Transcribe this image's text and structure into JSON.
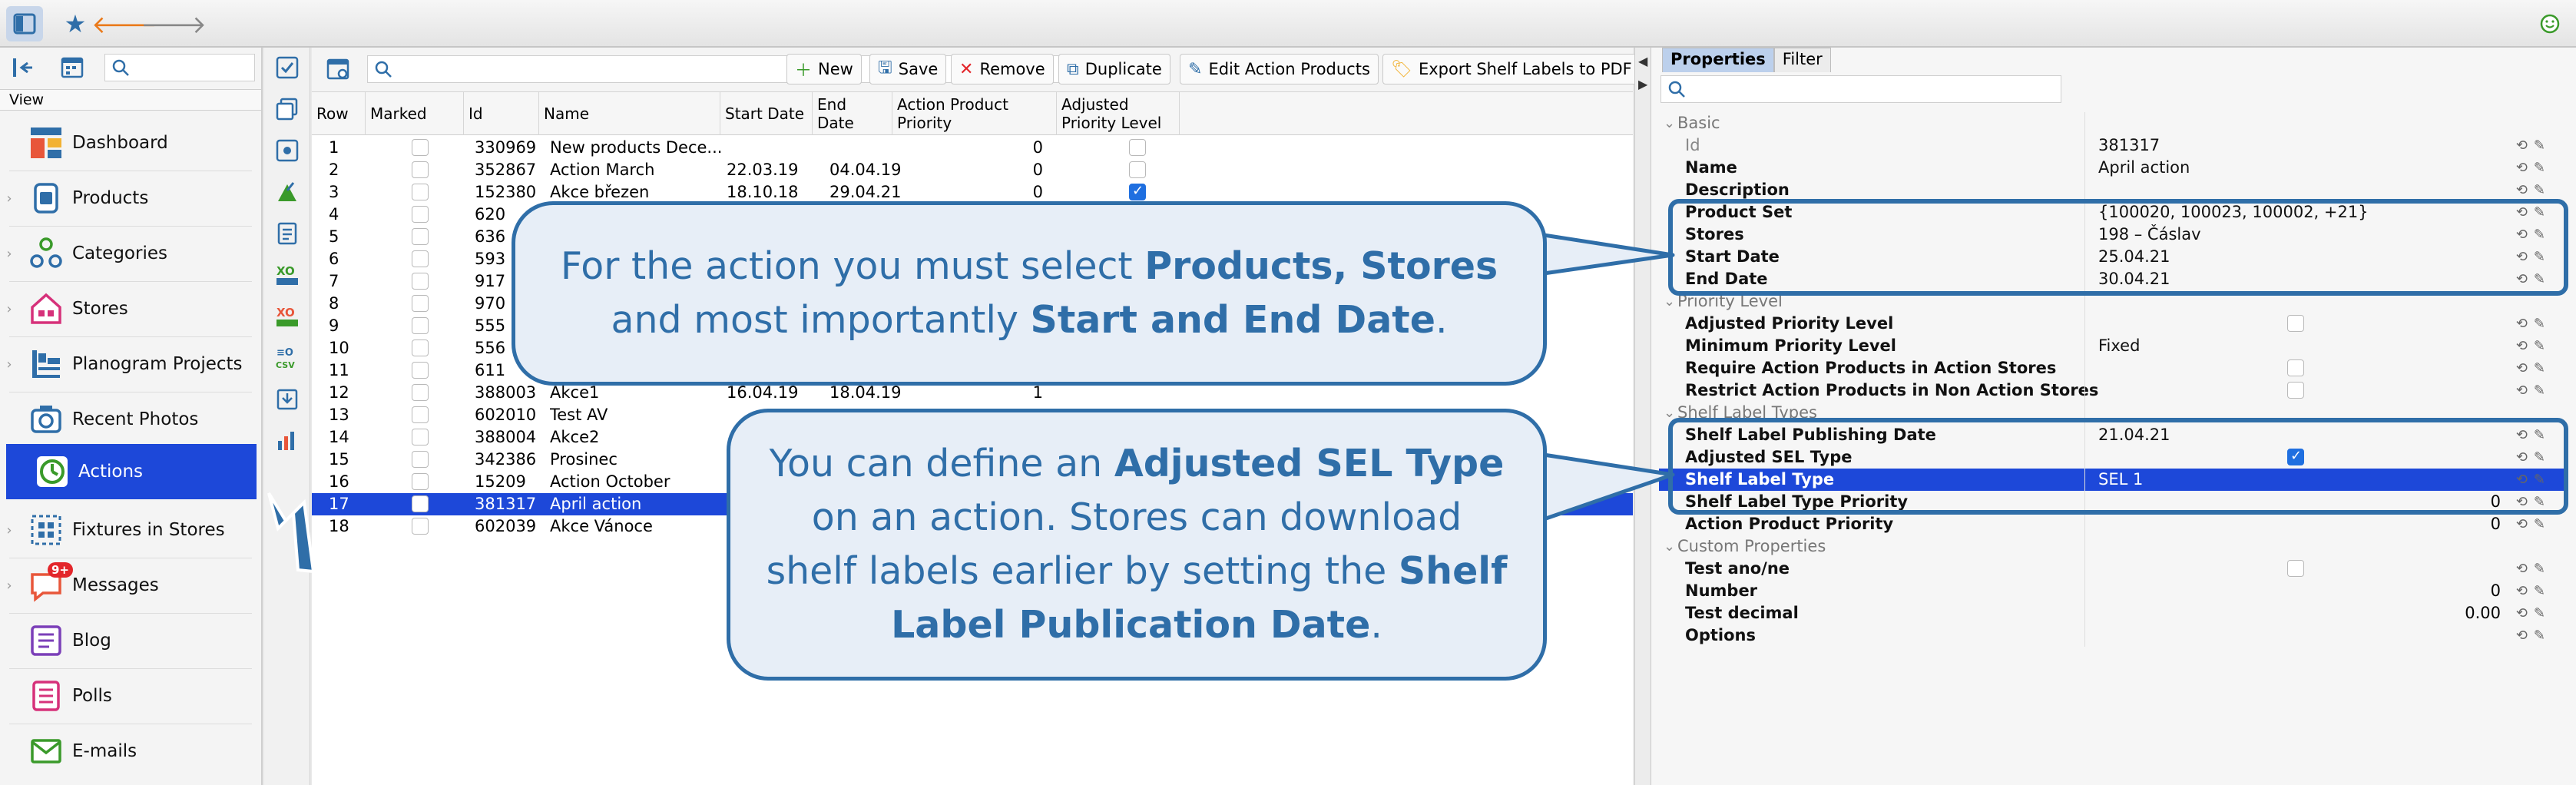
{
  "nav": {
    "view_label": "View",
    "items": [
      {
        "label": "Dashboard",
        "icon": "dashboard-icon"
      },
      {
        "label": "Products",
        "icon": "products-icon"
      },
      {
        "label": "Categories",
        "icon": "categories-icon"
      },
      {
        "label": "Stores",
        "icon": "stores-icon"
      },
      {
        "label": "Planogram Projects",
        "icon": "planogram-icon"
      },
      {
        "label": "Recent Photos",
        "icon": "camera-icon"
      },
      {
        "label": "Actions",
        "icon": "actions-icon",
        "active": true
      },
      {
        "label": "Fixtures in Stores",
        "icon": "fixtures-icon"
      },
      {
        "label": "Messages",
        "icon": "messages-icon",
        "badge": "9+"
      },
      {
        "label": "Blog",
        "icon": "blog-icon"
      },
      {
        "label": "Polls",
        "icon": "polls-icon"
      },
      {
        "label": "E-mails",
        "icon": "email-icon"
      }
    ]
  },
  "toolbar": {
    "new": "New",
    "save": "Save",
    "remove": "Remove",
    "duplicate": "Duplicate",
    "edit_action_products": "Edit Action Products",
    "export_labels": "Export Shelf Labels to PDF"
  },
  "table": {
    "headers": [
      "Row",
      "Marked",
      "Id",
      "Name",
      "Start Date",
      "End Date",
      "Action Product Priority",
      "Adjusted Priority Level"
    ],
    "rows": [
      {
        "row": "1",
        "id": "330969",
        "name": "New products Dece...",
        "start": "",
        "end": "",
        "prio": "0",
        "adj": false
      },
      {
        "row": "2",
        "id": "352867",
        "name": "Action March",
        "start": "22.03.19",
        "end": "04.04.19",
        "prio": "0",
        "adj": false
      },
      {
        "row": "3",
        "id": "152380",
        "name": "Akce březen",
        "start": "18.10.18",
        "end": "29.04.21",
        "prio": "0",
        "adj": true
      },
      {
        "row": "4",
        "id": "620",
        "name": "",
        "start": "",
        "end": "",
        "prio": "",
        "adj": false
      },
      {
        "row": "5",
        "id": "636",
        "name": "",
        "start": "",
        "end": "",
        "prio": "",
        "adj": false
      },
      {
        "row": "6",
        "id": "593",
        "name": "",
        "start": "",
        "end": "",
        "prio": "",
        "adj": false
      },
      {
        "row": "7",
        "id": "917",
        "name": "",
        "start": "",
        "end": "",
        "prio": "",
        "adj": false
      },
      {
        "row": "8",
        "id": "970",
        "name": "",
        "start": "",
        "end": "",
        "prio": "",
        "adj": false
      },
      {
        "row": "9",
        "id": "555",
        "name": "",
        "start": "",
        "end": "",
        "prio": "",
        "adj": false
      },
      {
        "row": "10",
        "id": "556",
        "name": "",
        "start": "",
        "end": "",
        "prio": "",
        "adj": false
      },
      {
        "row": "11",
        "id": "611",
        "name": "",
        "start": "",
        "end": "",
        "prio": "",
        "adj": false
      },
      {
        "row": "12",
        "id": "388003",
        "name": "Akce1",
        "start": "16.04.19",
        "end": "18.04.19",
        "prio": "1",
        "adj": false
      },
      {
        "row": "13",
        "id": "602010",
        "name": "Test AV",
        "start": "",
        "end": "",
        "prio": "",
        "adj": false
      },
      {
        "row": "14",
        "id": "388004",
        "name": "Akce2",
        "start": "",
        "end": "",
        "prio": "",
        "adj": false
      },
      {
        "row": "15",
        "id": "342386",
        "name": "Prosinec",
        "start": "",
        "end": "",
        "prio": "",
        "adj": false
      },
      {
        "row": "16",
        "id": "15209",
        "name": "Action October",
        "start": "",
        "end": "",
        "prio": "",
        "adj": false
      },
      {
        "row": "17",
        "id": "381317",
        "name": "April action",
        "start": "",
        "end": "",
        "prio": "",
        "adj": false,
        "selected": true
      },
      {
        "row": "18",
        "id": "602039",
        "name": "Akce Vánoce",
        "start": "",
        "end": "",
        "prio": "",
        "adj": false
      }
    ]
  },
  "props": {
    "tab_properties": "Properties",
    "tab_filter": "Filter",
    "sec_basic": "Basic",
    "id_label": "Id",
    "id_value": "381317",
    "name_label": "Name",
    "name_value": "April action",
    "desc_label": "Description",
    "productset_label": "Product Set",
    "productset_value": "{100020, 100023, 100002, +21}",
    "stores_label": "Stores",
    "stores_value": "198 – Čáslav",
    "start_label": "Start Date",
    "start_value": "25.04.21",
    "end_label": "End Date",
    "end_value": "30.04.21",
    "sec_priority": "Priority Level",
    "adj_prio_label": "Adjusted Priority Level",
    "min_prio_label": "Minimum Priority Level",
    "min_prio_value": "Fixed",
    "req_label": "Require Action Products in Action Stores",
    "restrict_label": "Restrict Action Products in Non Action Stores",
    "sec_shelf": "Shelf Label Types",
    "slpub_label": "Shelf Label Publishing Date",
    "slpub_value": "21.04.21",
    "adjsel_label": "Adjusted SEL Type",
    "sltype_label": "Shelf Label Type",
    "sltype_value": "SEL 1",
    "sltprio_label": "Shelf Label Type Priority",
    "sltprio_value": "0",
    "app_label": "Action Product Priority",
    "app_value": "0",
    "sec_custom": "Custom Properties",
    "testano_label": "Test ano/ne",
    "number_label": "Number",
    "number_value": "0",
    "testdec_label": "Test decimal",
    "testdec_value": "0.00",
    "options_label": "Options"
  },
  "callouts": {
    "c1_a": "For the action you must select ",
    "c1_b": "Products, Stores",
    "c1_c": " and most importantly ",
    "c1_d": "Start and End Date",
    "c1_e": ".",
    "c2_a": "You can define an ",
    "c2_b": "Adjusted SEL Type",
    "c2_c": " on an action. Stores can download shelf labels earlier by setting the ",
    "c2_d": "Shelf Label Publication Date",
    "c2_e": "."
  },
  "colors": {
    "accent": "#1d48d9",
    "callout": "#2f6ea8"
  }
}
